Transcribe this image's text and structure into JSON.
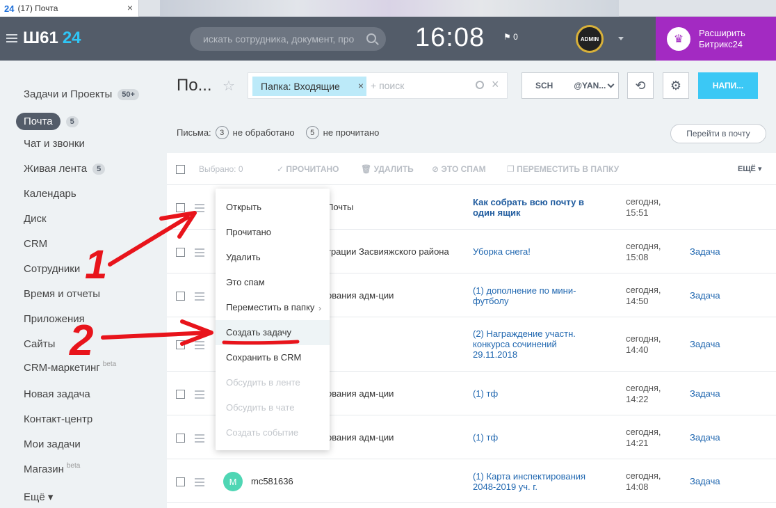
{
  "browser": {
    "tab_badge": "24",
    "tab_title": "(17) Почта",
    "tab_close": "×"
  },
  "header": {
    "logo_main": "Ш61",
    "logo_num": "24",
    "search_placeholder": "искать сотрудника, документ, про",
    "clock": "16:08",
    "flag_count": "0",
    "avatar_text": "ADMIN",
    "upgrade_line1": "Расширить",
    "upgrade_line2": "Битрикс24"
  },
  "sidebar": {
    "items": [
      {
        "label": "Задачи и Проекты",
        "count": "50+"
      },
      {
        "label": "Почта",
        "count": "5",
        "active": true
      },
      {
        "label": "Чат и звонки"
      },
      {
        "label": "Живая лента",
        "count": "5"
      },
      {
        "label": "Календарь"
      },
      {
        "label": "Диск"
      },
      {
        "label": "CRM"
      },
      {
        "label": "Сотрудники"
      },
      {
        "label": "Время и отчеты"
      },
      {
        "label": "Приложения"
      },
      {
        "label": "Сайты"
      },
      {
        "label": "CRM-маркетинг",
        "sup": "beta"
      },
      {
        "label": "Новая задача"
      },
      {
        "label": "Контакт-центр"
      },
      {
        "label": "Мои задачи"
      },
      {
        "label": "Магазин",
        "sup": "beta"
      },
      {
        "label": "Ещё ▾"
      }
    ]
  },
  "main": {
    "title": "По...",
    "filter_chip": "Папка: Входящие",
    "filter_chip_close": "×",
    "filter_placeholder": "+ поиск",
    "mailbox_left": "SCH",
    "mailbox_right": "@YAN...",
    "write_button": "НАПИ...",
    "stats_label": "Письма:",
    "stats_unprocessed_count": "3",
    "stats_unprocessed_label": "не обработано",
    "stats_unread_count": "5",
    "stats_unread_label": "не прочитано",
    "go_mail": "Перейти в почту"
  },
  "toolbar": {
    "selected": "Выбрано: 0",
    "read": "ПРОЧИТАНО",
    "delete": "УДАЛИТЬ",
    "spam": "ЭТО СПАМ",
    "move": "ПЕРЕМЕСТИТЬ В ПАПКУ",
    "more": "ЕЩЁ ▾"
  },
  "rows": [
    {
      "from": "Почты",
      "subject_lines": [
        "Как собрать всю почту в",
        "один ящик"
      ],
      "bold": true,
      "date1": "сегодня,",
      "date2": "15:51",
      "task": ""
    },
    {
      "from": "трации Засвияжского района",
      "subject_lines": [
        "Уборка снега!"
      ],
      "date1": "сегодня,",
      "date2": "15:08",
      "task": "Задача"
    },
    {
      "from": "ования адм-ции",
      "subject_lines": [
        "(1) дополнение по мини-",
        "футболу"
      ],
      "date1": "сегодня,",
      "date2": "14:50",
      "task": "Задача"
    },
    {
      "from": "",
      "subject_lines": [
        "(2) Награждение участн.",
        "конкурса сочинений",
        "29.11.2018"
      ],
      "date1": "сегодня,",
      "date2": "14:40",
      "task": "Задача"
    },
    {
      "from": "ования адм-ции",
      "subject_lines": [
        "(1) тф"
      ],
      "date1": "сегодня,",
      "date2": "14:22",
      "task": "Задача"
    },
    {
      "from": "ования адм-ции",
      "subject_lines": [
        "(1) тф"
      ],
      "date1": "сегодня,",
      "date2": "14:21",
      "task": "Задача"
    },
    {
      "from": "mc581636",
      "avatar": "M",
      "subject_lines": [
        "(1) Карта инспектирования",
        "2048-2019 уч. г."
      ],
      "date1": "сегодня,",
      "date2": "14:08",
      "task": "Задача"
    }
  ],
  "context_menu": {
    "items": [
      {
        "label": "Открыть"
      },
      {
        "label": "Прочитано"
      },
      {
        "label": "Удалить"
      },
      {
        "label": "Это спам"
      },
      {
        "label": "Переместить в папку"
      },
      {
        "label": "Создать задачу",
        "highlighted": true
      },
      {
        "label": "Сохранить в CRM"
      },
      {
        "label": "Обсудить в ленте",
        "disabled": true
      },
      {
        "label": "Обсудить в чате",
        "disabled": true
      },
      {
        "label": "Создать событие",
        "disabled": true
      }
    ]
  },
  "annotations": {
    "label1": "1",
    "label2": "2",
    "color": "#e8141b"
  }
}
